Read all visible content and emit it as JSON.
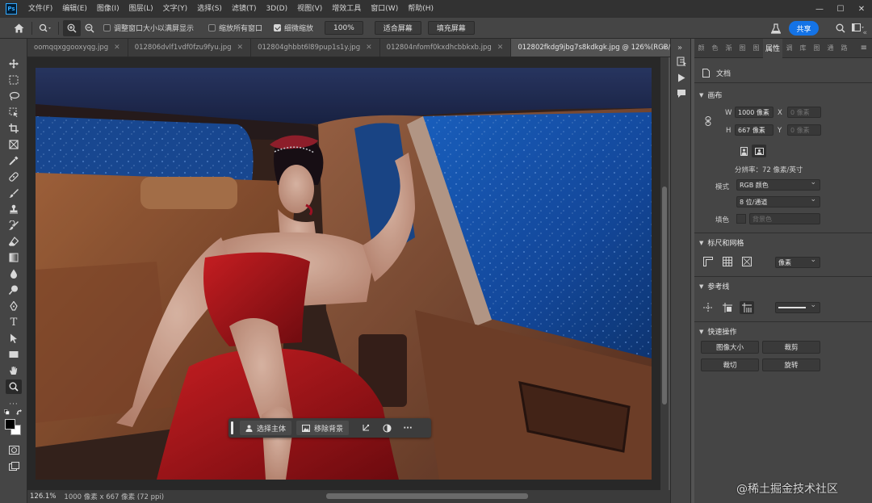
{
  "app": {
    "logo": "Ps"
  },
  "menu": [
    "文件(F)",
    "编辑(E)",
    "图像(I)",
    "图层(L)",
    "文字(Y)",
    "选择(S)",
    "滤镜(T)",
    "3D(D)",
    "视图(V)",
    "增效工具",
    "窗口(W)",
    "帮助(H)"
  ],
  "window_controls": {
    "minimize": "—",
    "maximize": "☐",
    "close": "✕"
  },
  "options": {
    "resize_windows_label": "调整窗口大小以满屏显示",
    "zoom_all_label": "缩放所有窗口",
    "scrubby_zoom_label": "细微缩放",
    "scrubby_zoom_checked": true,
    "zoom_value": "100%",
    "fit_screen": "适合屏幕",
    "fill_screen": "填充屏幕",
    "share": "共享"
  },
  "tabs": [
    {
      "label": "oomqqxggooxyqg.jpg",
      "active": false
    },
    {
      "label": "012806dvlf1vdf0fzu9fyu.jpg",
      "active": false
    },
    {
      "label": "012804ghbbt6l89pup1s1y.jpg",
      "active": false
    },
    {
      "label": "012804nfomf0kxdhcbbkxb.jpg",
      "active": false
    },
    {
      "label": "012802fkdg9jbg7s8kdkgk.jpg @ 126%(RGB/8#)",
      "active": true
    }
  ],
  "status": {
    "zoom": "126.1%",
    "info": "1000 像素 x 667 像素 (72 ppi)"
  },
  "contextual_bar": {
    "select_subject": "选择主体",
    "remove_background": "移除背景",
    "more": "···"
  },
  "properties": {
    "tabs": [
      "颜",
      "色",
      "渐",
      "图",
      "图",
      "属性",
      "调",
      "库",
      "图",
      "通",
      "路"
    ],
    "active_tab": "属性",
    "doc_label": "文档",
    "canvas": {
      "title": "画布",
      "w_label": "W",
      "w_value": "1000 像素",
      "h_label": "H",
      "h_value": "667 像素",
      "x_label": "X",
      "x_value": "0 像素",
      "y_label": "Y",
      "y_value": "0 像素",
      "resolution": "分辨率：72 像素/英寸",
      "mode_label": "模式",
      "mode_value": "RGB 颜色",
      "depth_value": "8 位/通道",
      "fill_label": "填色",
      "fill_value": "背景色"
    },
    "rulers": {
      "title": "标尺和网格",
      "unit": "像素"
    },
    "guides": {
      "title": "参考线"
    },
    "quick_actions": {
      "title": "快速操作",
      "image_size": "图像大小",
      "crop": "裁剪",
      "trim": "裁切",
      "rotate": "旋转"
    }
  },
  "watermark": "@稀土掘金技术社区"
}
